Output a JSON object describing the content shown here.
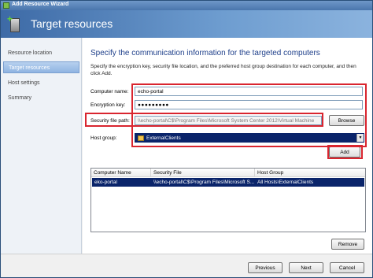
{
  "window": {
    "title": "Add Resource Wizard"
  },
  "header": {
    "title": "Target resources",
    "icon": "server-add-icon"
  },
  "sidebar": {
    "items": [
      {
        "label": "Resource location",
        "active": false
      },
      {
        "label": "Target resources",
        "active": true
      },
      {
        "label": "Host settings",
        "active": false
      },
      {
        "label": "Summary",
        "active": false
      }
    ]
  },
  "main": {
    "heading": "Specify the communication information for the targeted computers",
    "description": "Specify the encryption key, security file location, and the preferred host group destination for each computer, and then click Add.",
    "computer_name": {
      "label": "Computer name:",
      "value": "echo-portal"
    },
    "encryption_key": {
      "label": "Encryption key:",
      "value": "●●●●●●●●●"
    },
    "security_file": {
      "label": "Security file path:",
      "value": "\\\\echo-portal\\C$\\Program Files\\Microsoft System Center 2012\\Virtual Machine"
    },
    "browse_button": "Browse",
    "host_group": {
      "label": "Host group:",
      "value": "ExternalClients"
    },
    "add_button": "Add",
    "table": {
      "columns": [
        "Computer Name",
        "Security File",
        "Host Group"
      ],
      "rows": [
        {
          "computer": "eko-portal",
          "file": "\\\\echo-portal\\C$\\Program Files\\Microsoft S...",
          "group": "All Hosts\\ExternalClients"
        }
      ]
    },
    "remove_button": "Remove"
  },
  "footer": {
    "previous": "Previous",
    "next": "Next",
    "cancel": "Cancel"
  },
  "colors": {
    "highlight": "#d9252f",
    "selection": "#0a246a",
    "heading": "#1e3f8a"
  }
}
